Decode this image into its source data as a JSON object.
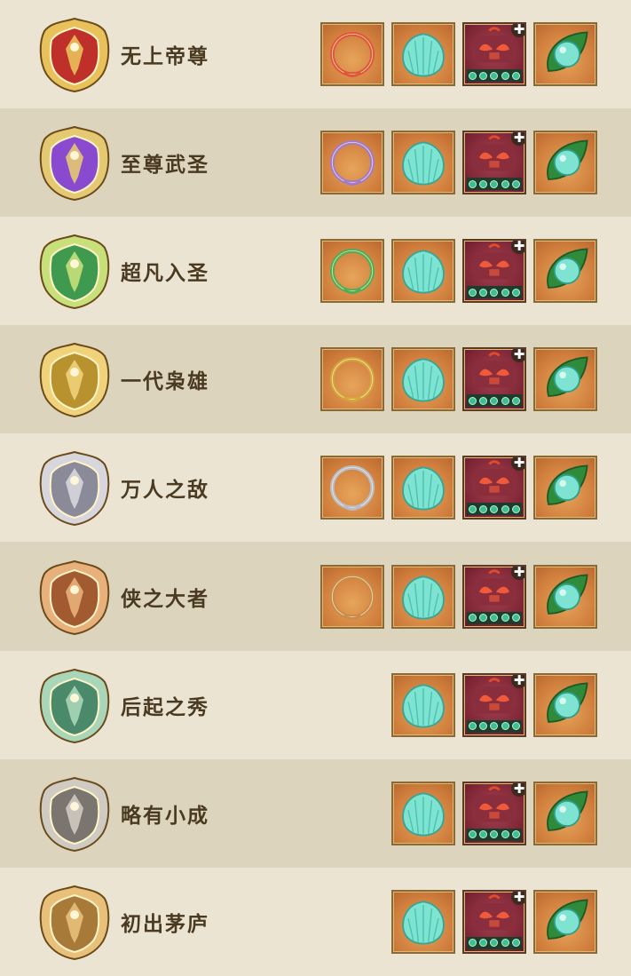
{
  "ranks": [
    {
      "name": "无上帝尊",
      "badge_colors": [
        "#e8c15a",
        "#c0302a"
      ],
      "ring_color": "#e0563a",
      "rewards": [
        "ring-frame",
        "shell",
        "mask",
        "leaf-orb"
      ]
    },
    {
      "name": "至尊武圣",
      "badge_colors": [
        "#e5c872",
        "#8a4ad0"
      ],
      "ring_color": "#a27acd",
      "rewards": [
        "ring-frame",
        "shell",
        "mask",
        "leaf-orb"
      ]
    },
    {
      "name": "超凡入圣",
      "badge_colors": [
        "#c7e07a",
        "#3f9a4f"
      ],
      "ring_color": "#4fae55",
      "rewards": [
        "ring-frame",
        "shell",
        "mask",
        "leaf-orb"
      ]
    },
    {
      "name": "一代枭雄",
      "badge_colors": [
        "#f0d27a",
        "#b8922e"
      ],
      "ring_color": "#d4a53a",
      "rewards": [
        "ring-frame",
        "shell",
        "mask",
        "leaf-orb"
      ]
    },
    {
      "name": "万人之敌",
      "badge_colors": [
        "#d6d6dc",
        "#8a8a98"
      ],
      "ring_color": "#b9bcc8",
      "rewards": [
        "ring-frame",
        "shell",
        "mask",
        "leaf-orb"
      ]
    },
    {
      "name": "侠之大者",
      "badge_colors": [
        "#e8b07a",
        "#a25a30"
      ],
      "ring_color": "#c98a4a",
      "rewards": [
        "ring-frame",
        "shell",
        "mask",
        "leaf-orb"
      ]
    },
    {
      "name": "后起之秀",
      "badge_colors": [
        "#a9d6b8",
        "#4a8a6a"
      ],
      "ring_color": "",
      "rewards": [
        "shell",
        "mask",
        "leaf-orb"
      ]
    },
    {
      "name": "略有小成",
      "badge_colors": [
        "#cfcac2",
        "#7a756e"
      ],
      "ring_color": "",
      "rewards": [
        "shell",
        "mask",
        "leaf-orb"
      ]
    },
    {
      "name": "初出茅庐",
      "badge_colors": [
        "#e8c07a",
        "#a87a3a"
      ],
      "ring_color": "",
      "rewards": [
        "shell",
        "mask",
        "leaf-orb"
      ]
    }
  ]
}
